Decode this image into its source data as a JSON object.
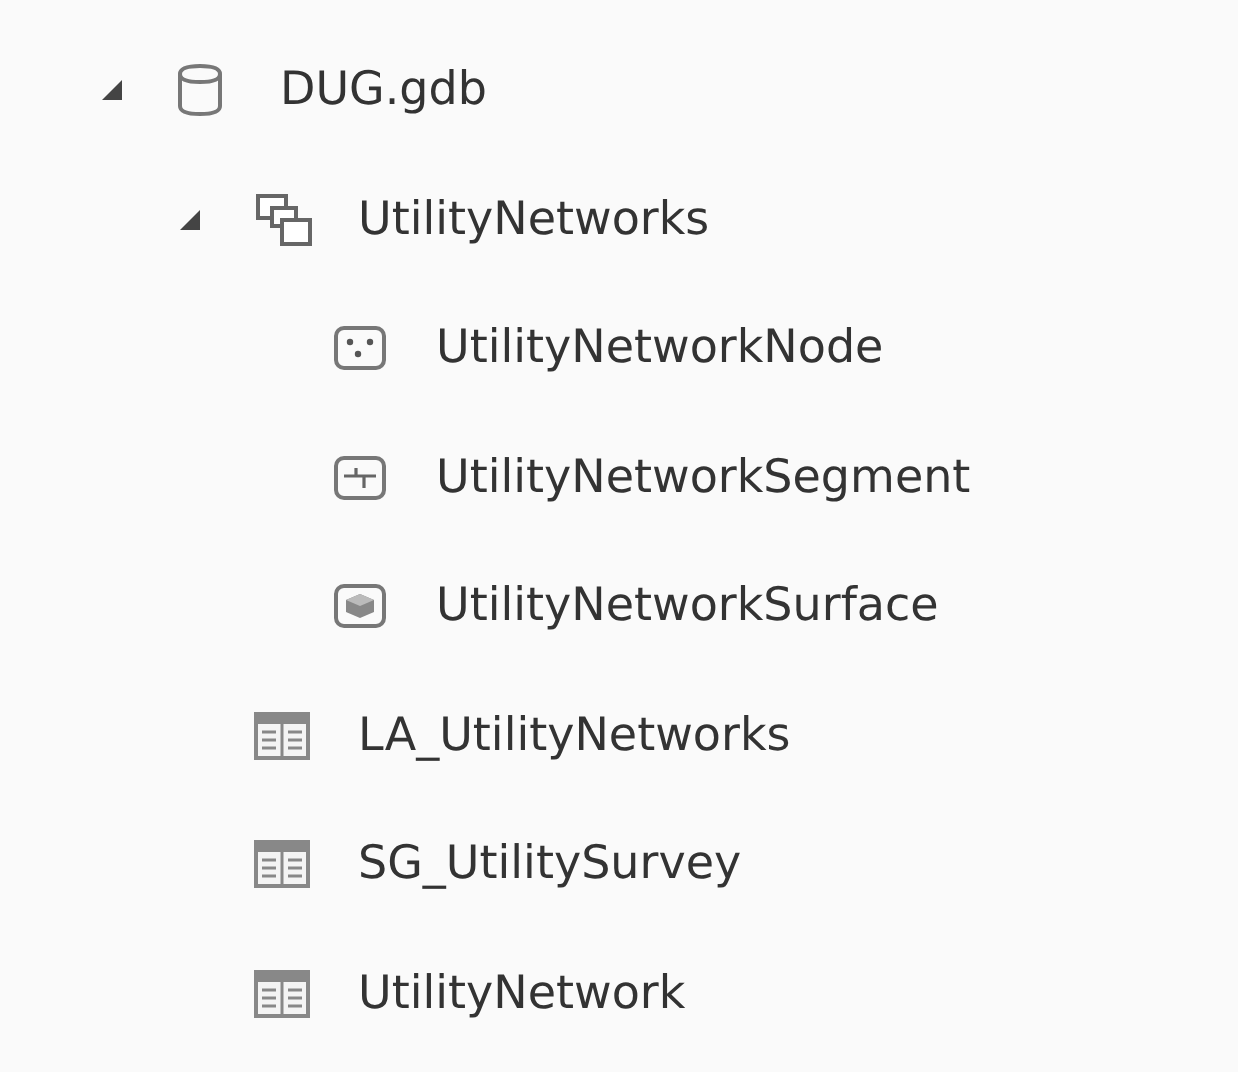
{
  "tree": [
    {
      "label": "DUG.gdb",
      "kind": "database",
      "expanded": true,
      "children": [
        {
          "label": "UtilityNetworks",
          "kind": "dataset",
          "expanded": true,
          "children": [
            {
              "label": "UtilityNetworkNode",
              "kind": "points"
            },
            {
              "label": "UtilityNetworkSegment",
              "kind": "lines"
            },
            {
              "label": "UtilityNetworkSurface",
              "kind": "surface"
            }
          ]
        },
        {
          "label": "LA_UtilityNetworks",
          "kind": "table"
        },
        {
          "label": "SG_UtilitySurvey",
          "kind": "table"
        },
        {
          "label": "UtilityNetwork",
          "kind": "table"
        }
      ]
    }
  ]
}
